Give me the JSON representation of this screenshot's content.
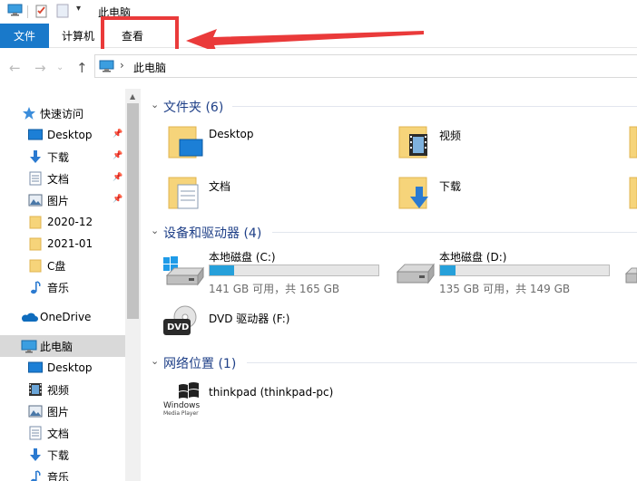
{
  "window": {
    "title": "此电脑"
  },
  "ribbon": {
    "tabs": [
      "文件",
      "计算机",
      "查看"
    ]
  },
  "address": {
    "path": "此电脑"
  },
  "sidebar": {
    "quick_access": "快速访问",
    "quick_items": [
      {
        "label": "Desktop",
        "icon": "desktop-icon",
        "pinned": true
      },
      {
        "label": "下载",
        "icon": "download-icon",
        "pinned": true
      },
      {
        "label": "文档",
        "icon": "document-icon",
        "pinned": true
      },
      {
        "label": "图片",
        "icon": "picture-icon",
        "pinned": true
      },
      {
        "label": "2020-12",
        "icon": "folder-icon",
        "pinned": false
      },
      {
        "label": "2021-01",
        "icon": "folder-icon",
        "pinned": false
      },
      {
        "label": "C盘",
        "icon": "folder-icon",
        "pinned": false
      },
      {
        "label": "音乐",
        "icon": "music-icon",
        "pinned": false
      }
    ],
    "onedrive": "OneDrive",
    "this_pc": "此电脑",
    "pc_items": [
      {
        "label": "Desktop",
        "icon": "desktop-icon"
      },
      {
        "label": "视频",
        "icon": "video-icon"
      },
      {
        "label": "图片",
        "icon": "picture-icon"
      },
      {
        "label": "文档",
        "icon": "document-icon"
      },
      {
        "label": "下载",
        "icon": "download-icon"
      },
      {
        "label": "音乐",
        "icon": "music-icon"
      }
    ]
  },
  "content": {
    "folders_header": "文件夹 (6)",
    "folders": [
      {
        "label": "Desktop",
        "icon": "desktop-folder-icon"
      },
      {
        "label": "视频",
        "icon": "video-folder-icon"
      },
      {
        "label": "文档",
        "icon": "document-folder-icon"
      },
      {
        "label": "下载",
        "icon": "download-folder-icon"
      }
    ],
    "devices_header": "设备和驱动器 (4)",
    "drives": [
      {
        "label": "本地磁盘 (C:)",
        "sub": "141 GB 可用，共 165 GB",
        "used_fraction": 0.145
      },
      {
        "label": "本地磁盘 (D:)",
        "sub": "135 GB 可用，共 149 GB",
        "used_fraction": 0.094
      }
    ],
    "dvd": {
      "label": "DVD 驱动器 (F:)",
      "icon_text": "DVD"
    },
    "network_header": "网络位置 (1)",
    "network": [
      {
        "label": "thinkpad (thinkpad-pc)",
        "icon": "windows-media-player-icon",
        "icon_text_1": "Windows",
        "icon_text_2": "Media Player"
      }
    ]
  },
  "colors": {
    "accent": "#1979ca",
    "highlight": "#ea3a3a",
    "group_header": "#1e3f87",
    "drive_fill": "#26a0da"
  }
}
